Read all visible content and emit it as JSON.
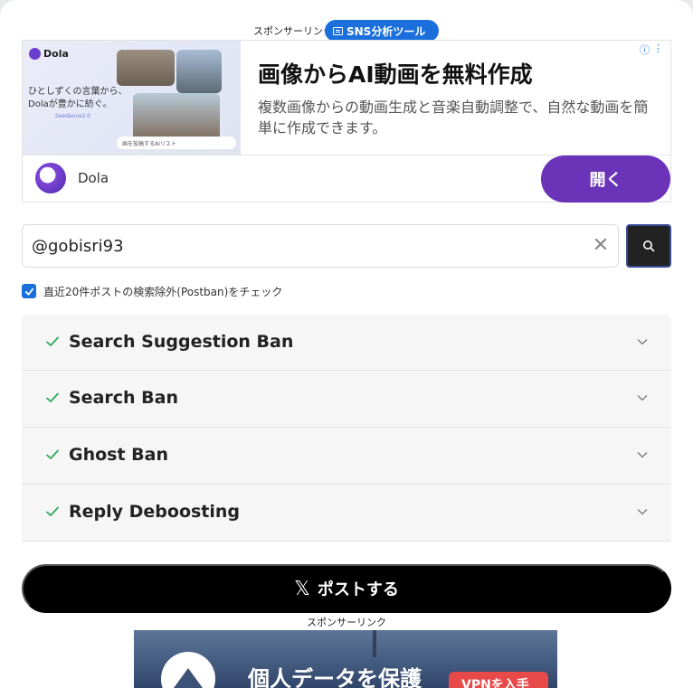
{
  "sponsor": {
    "label": "スポンサーリンク",
    "pill": "SNS分析ツール"
  },
  "ad": {
    "image": {
      "brand": "Dola",
      "tagline": "ひとしずくの言葉から、Dolaが豊かに紡ぐ。",
      "version": "Seedance2.0",
      "prompt": "画を投稿するAIリスト"
    },
    "title": "画像からAI動画を無料作成",
    "description": "複数画像からの動画生成と音楽自動調整で、自然な動画を簡単に作成できます。",
    "advertiser": "Dola",
    "open_label": "開く",
    "info_icon": "info-icon",
    "menu_icon": "kebab-icon"
  },
  "search": {
    "value": "@gobisri93",
    "clear_icon": "close-icon",
    "search_icon": "search-icon"
  },
  "option": {
    "checked": true,
    "label": "直近20件ポストの検索除外(Postban)をチェック"
  },
  "results": [
    {
      "label": "Search Suggestion Ban",
      "status": "ok"
    },
    {
      "label": "Search Ban",
      "status": "ok"
    },
    {
      "label": "Ghost Ban",
      "status": "ok"
    },
    {
      "label": "Reply Deboosting",
      "status": "ok"
    }
  ],
  "post_button": {
    "icon": "x-logo",
    "label": "ポストする"
  },
  "sponsor2": {
    "label": "スポンサーリンク",
    "headline": "個人データを保護",
    "cta": "VPNを入手"
  },
  "colors": {
    "accent_blue": "#1a6fdc",
    "ad_purple": "#6a33b8",
    "check_green": "#2eaa5c"
  }
}
